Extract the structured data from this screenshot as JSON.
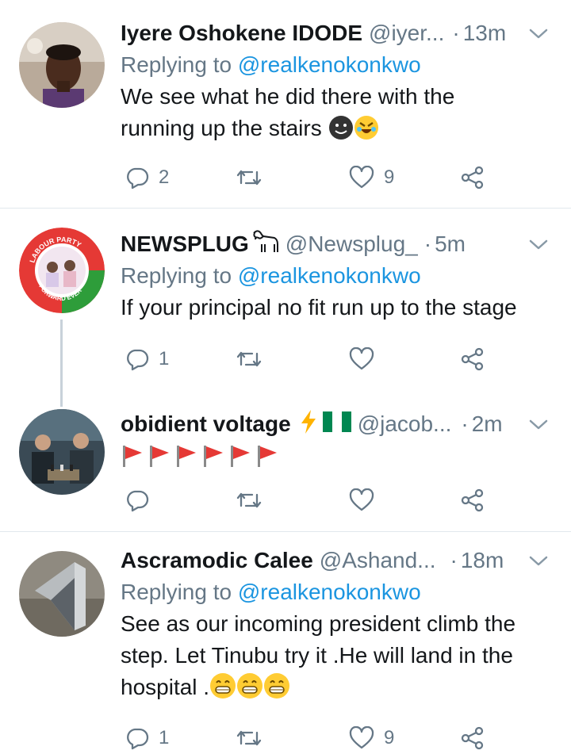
{
  "tweets": [
    {
      "name": "Iyere Oshokene IDODE",
      "handle": "@iyer...",
      "dot": "·",
      "time": "13m",
      "replying_prefix": "Replying to",
      "replying_to": "@realkenokonkwo",
      "text_line1": "We see what he did there with the",
      "text_line2": "running up the stairs",
      "emojis": [
        "smiling-black-face",
        "rofl-face"
      ],
      "replies": "2",
      "retweets": "",
      "likes": "9"
    },
    {
      "name": "NEWSPLUG",
      "name_icon": "goat-icon",
      "handle": "@Newsplug_",
      "dot": "·",
      "time": "5m",
      "replying_prefix": "Replying to",
      "replying_to": "@realkenokonkwo",
      "text_line1": "If your principal no fit run up to the stage",
      "replies": "1",
      "retweets": "",
      "likes": "",
      "avatar_text_top": "LABOUR PARTY",
      "avatar_text_bottom": "FORWARD EVER"
    },
    {
      "name": "obidient voltage",
      "name_icons": [
        "lightning-icon",
        "nigeria-flag-icon"
      ],
      "handle": "@jacob...",
      "dot": "·",
      "time": "2m",
      "flags_count": 6,
      "replies": "",
      "retweets": "",
      "likes": ""
    },
    {
      "name": "Ascramodic Calee",
      "handle": "@Ashand...",
      "dot": "·",
      "time": "18m",
      "replying_prefix": "Replying to",
      "replying_to": "@realkenokonkwo",
      "text_line1": "See as our incoming president climb the",
      "text_line2": "step. Let Tinubu try it .He will land in the",
      "text_line3": "hospital .",
      "emojis": [
        "grinning-face",
        "grinning-face",
        "grinning-face"
      ],
      "replies": "1",
      "retweets": "",
      "likes": "9"
    }
  ],
  "colors": {
    "link": "#1b95e0",
    "muted": "#657786",
    "text": "#14171a",
    "divider": "#e1e8ed",
    "flag_red": "#e53935",
    "lightning": "#ffb300",
    "nigeria_green": "#008751"
  }
}
